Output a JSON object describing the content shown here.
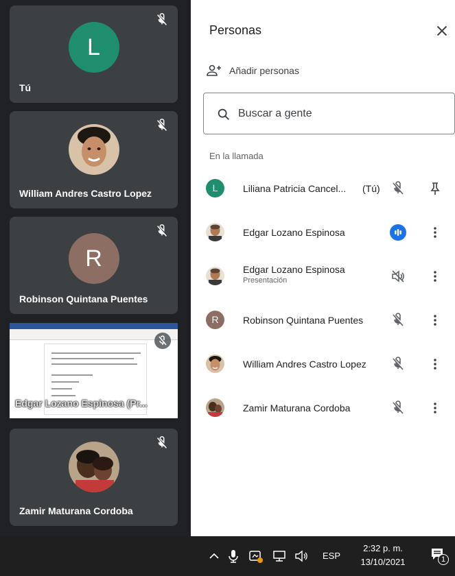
{
  "tiles": [
    {
      "name": "Tú",
      "avatar_letter": "L",
      "avatar_color": "#1e8e6e"
    },
    {
      "name": "William Andres Castro Lopez"
    },
    {
      "name": "Robinson Quintana Puentes",
      "avatar_letter": "R",
      "avatar_color": "#8d6e63"
    },
    {
      "name": "Edgar Lozano Espinosa (Pr..."
    },
    {
      "name": "Zamir Maturana Cordoba"
    }
  ],
  "panel": {
    "title": "Personas",
    "add_people": "Añadir personas",
    "search_placeholder": "Buscar a gente",
    "section_label": "En la llamada"
  },
  "participants": [
    {
      "name": "Liliana Patricia Cancel...",
      "tag": "(Tú)",
      "avatar_letter": "L",
      "avatar_color": "#1e8e6e",
      "mic": "muted",
      "action": "pin-icon"
    },
    {
      "name": "Edgar Lozano Espinosa",
      "mic": "speaking",
      "action": "more-vert-icon"
    },
    {
      "name": "Edgar Lozano Espinosa",
      "subtitle": "Presentación",
      "mic": "audio-muted",
      "action": "more-vert-icon"
    },
    {
      "name": "Robinson Quintana Puentes",
      "avatar_letter": "R",
      "avatar_color": "#8d6e63",
      "mic": "muted",
      "action": "more-vert-icon"
    },
    {
      "name": "William Andres Castro Lopez",
      "mic": "muted",
      "action": "more-vert-icon"
    },
    {
      "name": "Zamir Maturana Cordoba",
      "mic": "muted",
      "action": "more-vert-icon"
    }
  ],
  "taskbar": {
    "language": "ESP",
    "time": "2:32 p. m.",
    "date": "13/10/2021",
    "notification_count": "1"
  },
  "colors": {
    "speaking_blue": "#1a73e8",
    "tile_bg": "#3c4043"
  }
}
